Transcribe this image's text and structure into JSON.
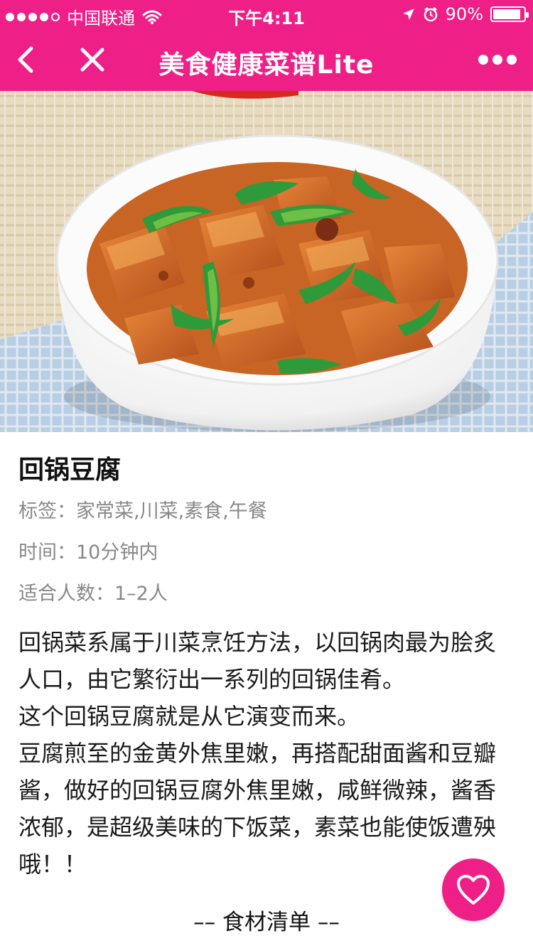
{
  "status_bar": {
    "carrier": "中国联通",
    "time": "下午4:11",
    "battery": "90%",
    "battery_level": 0.9
  },
  "nav": {
    "title": "美食健康菜谱Lite",
    "back_icon": "chevron-left-icon",
    "close_icon": "close-icon",
    "more_icon": "more-dots-icon"
  },
  "recipe": {
    "title": "回锅豆腐",
    "tags": "标签：家常菜,川菜,素食,午餐",
    "time": "时间：10分钟内",
    "servings": "适合人数：1–2人",
    "description": [
      "回锅菜系属于川菜烹饪方法，以回锅肉最为脍炙人口，由它繁衍出一系列的回锅佳肴。",
      "这个回锅豆腐就是从它演变而来。",
      "豆腐煎至的金黄外焦里嫩，再搭配甜面酱和豆瓣酱，做好的回锅豆腐外焦里嫩，咸鲜微辣，酱香浓郁，是超级美味的下饭菜，素菜也能使饭遭殃哦！！"
    ]
  },
  "ingredients_header": "–– 食材清单 ––",
  "favorite": {
    "icon": "heart-icon"
  },
  "colors": {
    "brand": "#ee1f87",
    "meta_text": "#888888",
    "body_text": "#1a1a1a"
  }
}
